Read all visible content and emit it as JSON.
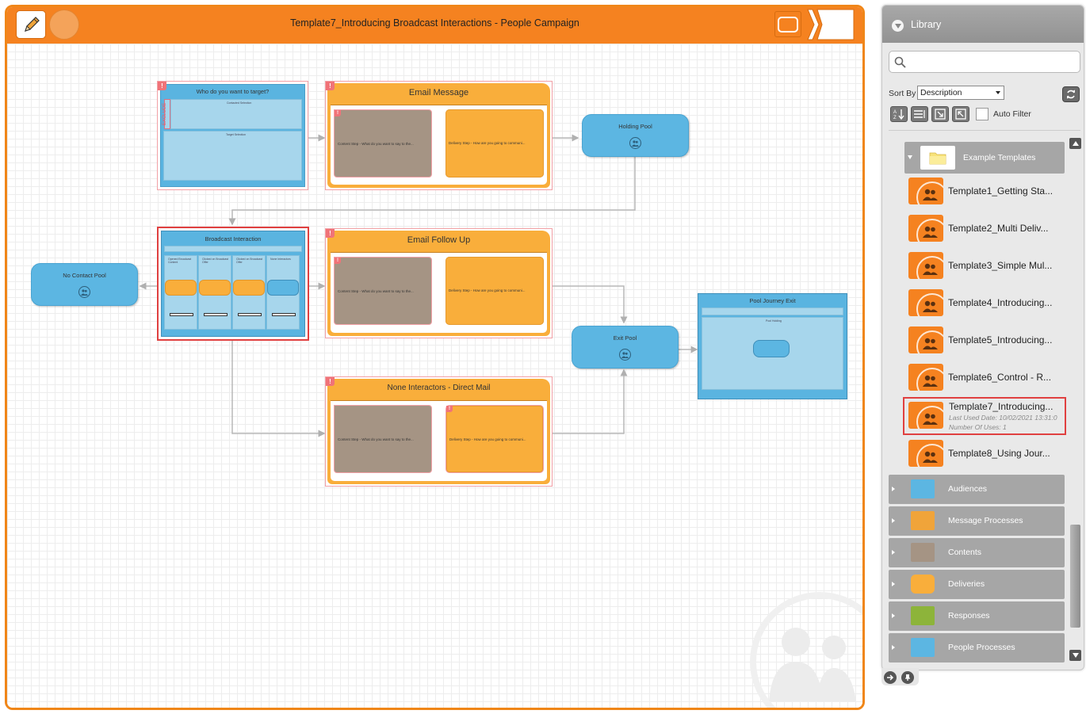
{
  "title_bar": {
    "title": "Template7_Introducing Broadcast Interactions - People Campaign"
  },
  "canvas": {
    "nodes": {
      "target": {
        "title": "Who do you want to target?",
        "exclude_label": "EXCLUDE",
        "upper_pane_label": "Contacted Selection",
        "lower_pane_label": "Target Selection"
      },
      "email_message": {
        "title": "Email Message",
        "content_label": "Content Step - What do you want to say to the...",
        "delivery_label": "Delivery Step - How are you going to communi..."
      },
      "holding_pool": {
        "title": "Holding Pool"
      },
      "broadcast": {
        "title": "Broadcast Interaction",
        "columns": [
          {
            "header": "Opened Broadcast Content",
            "tag": "No Broadcast Resp."
          },
          {
            "header": "Clicked on Broadcast Offer",
            "tag": "Opened Then Clicked"
          },
          {
            "header": "Clicked on Broadcast Offer",
            "tag": "Opened Then Clicked"
          },
          {
            "header": "None Interactors",
            "tag": "None Broadcast Interaction"
          }
        ]
      },
      "email_follow_up": {
        "title": "Email Follow Up",
        "content_label": "Content Step - What do you want to say to the...",
        "delivery_label": "Delivery Step - How are you going to communi..."
      },
      "no_contact_pool": {
        "title": "No Contact Pool"
      },
      "direct_mail": {
        "title": "None Interactors - Direct Mail",
        "content_label": "Content Step - What do you want to say to the...",
        "delivery_label": "Delivery Step - How are you going to communi..."
      },
      "exit_pool": {
        "title": "Exit Pool"
      },
      "pool_journey_exit": {
        "title": "Pool Journey Exit",
        "pane_label": "Pool Holding"
      }
    }
  },
  "library": {
    "title": "Library",
    "search": {
      "placeholder": "",
      "value": ""
    },
    "sort_by_label": "Sort By",
    "sort_by_value": "Description",
    "auto_filter_label": "Auto Filter",
    "auto_filter_checked": false,
    "folder": {
      "label": "Example Templates",
      "expanded": true
    },
    "templates": [
      {
        "name": "Template1_Getting Sta..."
      },
      {
        "name": "Template2_Multi Deliv..."
      },
      {
        "name": "Template3_Simple Mul..."
      },
      {
        "name": "Template4_Introducing..."
      },
      {
        "name": "Template5_Introducing..."
      },
      {
        "name": "Template6_Control - R..."
      },
      {
        "name": "Template7_Introducing...",
        "last_used": "Last Used Date: 10/02/2021 13:31:0",
        "uses": "Number Of Uses: 1",
        "selected": true
      },
      {
        "name": "Template8_Using Jour..."
      }
    ],
    "categories": [
      {
        "label": "Audiences",
        "color": "#5cb6e2"
      },
      {
        "label": "Message Processes",
        "color": "#f0a43a"
      },
      {
        "label": "Contents",
        "color": "#a59484"
      },
      {
        "label": "Deliveries",
        "color": "#f9ae3b"
      },
      {
        "label": "Responses",
        "color": "#8db43a"
      },
      {
        "label": "People Processes",
        "color": "#5cb6e2"
      }
    ]
  },
  "colors": {
    "brand_orange": "#f58220",
    "audience_blue": "#5cb6e2",
    "content_taupe": "#a59484",
    "delivery_orange": "#f9ae3b",
    "selection_red": "#e04040"
  },
  "icons": {
    "edit": "pencil-icon",
    "library_toggle": "chevron-down-icon",
    "search": "search-icon",
    "refresh": "refresh-icon",
    "pool": "people-icon"
  }
}
